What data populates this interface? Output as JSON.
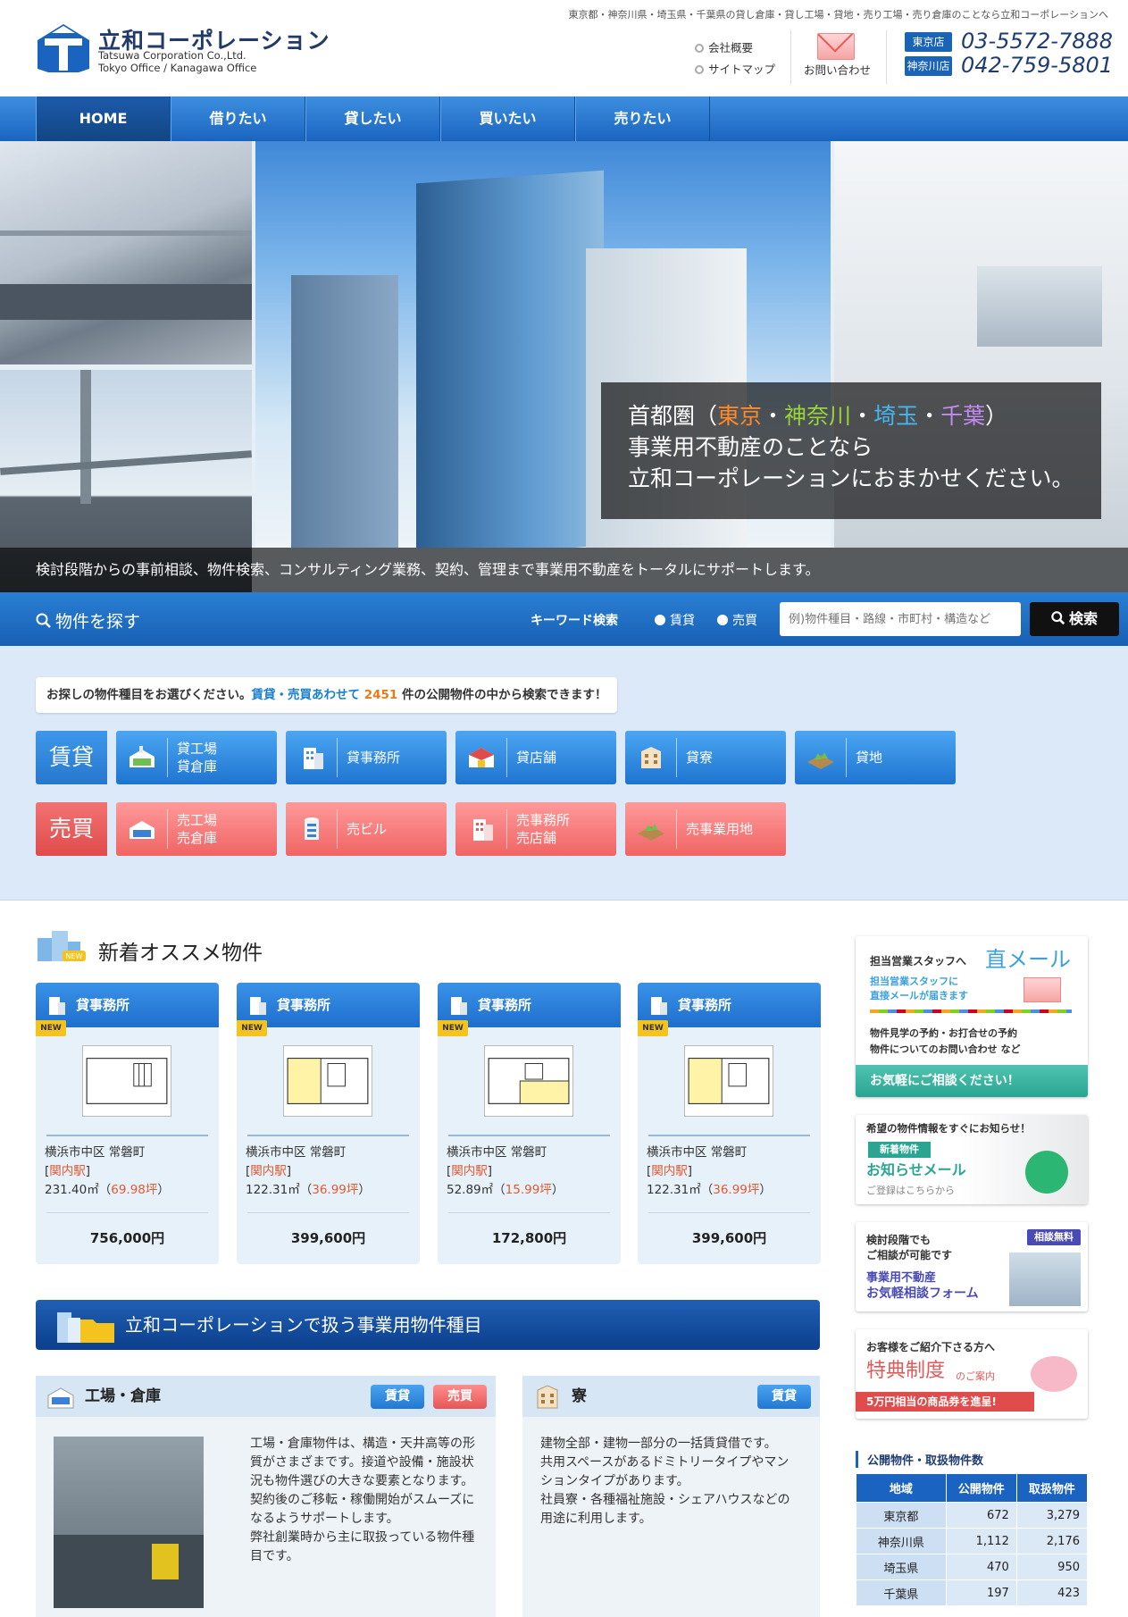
{
  "header": {
    "tagline": "東京都・神奈川県・埼玉県・千葉県の貸し倉庫・貸し工場・貸地・売り工場・売り倉庫のことなら立和コーポレーションへ",
    "company_name": "立和コーポレーション",
    "company_sub1": "Tatsuwa Corporation Co.,Ltd.",
    "company_sub2": "Tokyo Office / Kanagawa Office",
    "links": [
      "会社概要",
      "サイトマップ"
    ],
    "contact_label": "お問い合わせ",
    "offices": [
      {
        "badge": "東京店",
        "phone": "03-5572-7888"
      },
      {
        "badge": "神奈川店",
        "phone": "042-759-5801"
      }
    ]
  },
  "nav": [
    "HOME",
    "借りたい",
    "貸したい",
    "買いたい",
    "売りたい"
  ],
  "hero": {
    "lines": [
      "首都圏（",
      "東京",
      "・",
      "神奈川",
      "・",
      "埼玉",
      "・",
      "千葉",
      "）"
    ],
    "line2": "事業用不動産のことなら",
    "line3": "立和コーポレーションにおまかせください。",
    "caption": "検討段階からの事前相談、物件検索、コンサルティング業務、契約、管理まで事業用不動産をトータルにサポートします。",
    "colors": {
      "tokyo": "#ff8a2a",
      "kanagawa": "#9ad33a",
      "saitama": "#46b6f0",
      "chiba": "#c28af0"
    }
  },
  "search": {
    "title": "物件を探す",
    "keyword_label": "キーワード検索",
    "radio_lease": "賃貸",
    "radio_sale": "売買",
    "placeholder": "例)物件種目・路線・市町村・構造など",
    "button": "検索"
  },
  "categories": {
    "intro_a": "お探しの物件種目をお選びください。",
    "intro_b": "賃貸・売買あわせて",
    "intro_count": "2451",
    "intro_c": "件の公開物件の中から検索できます！",
    "lease_tag": "賃貸",
    "sale_tag": "売買",
    "lease": [
      {
        "l1": "貸工場",
        "l2": "貸倉庫"
      },
      {
        "l1": "貸事務所",
        "l2": ""
      },
      {
        "l1": "貸店舗",
        "l2": ""
      },
      {
        "l1": "貸寮",
        "l2": ""
      },
      {
        "l1": "貸地",
        "l2": ""
      }
    ],
    "sale": [
      {
        "l1": "売工場",
        "l2": "売倉庫"
      },
      {
        "l1": "売ビル",
        "l2": ""
      },
      {
        "l1": "売事務所",
        "l2": "売店舗"
      },
      {
        "l1": "売事業用地",
        "l2": ""
      }
    ]
  },
  "new_listings": {
    "title": "新着オススメ物件",
    "new_badge": "NEW",
    "items": [
      {
        "type": "貸事務所",
        "address": "横浜市中区 常磐町",
        "station": "関内駅",
        "area": "231.40㎡",
        "tsubo": "69.98坪",
        "price": "756,000円"
      },
      {
        "type": "貸事務所",
        "address": "横浜市中区 常磐町",
        "station": "関内駅",
        "area": "122.31㎡",
        "tsubo": "36.99坪",
        "price": "399,600円"
      },
      {
        "type": "貸事務所",
        "address": "横浜市中区 常磐町",
        "station": "関内駅",
        "area": "52.89㎡",
        "tsubo": "15.99坪",
        "price": "172,800円"
      },
      {
        "type": "貸事務所",
        "address": "横浜市中区 常磐町",
        "station": "関内駅",
        "area": "122.31㎡",
        "tsubo": "36.99坪",
        "price": "399,600円"
      }
    ]
  },
  "types_banner": "立和コーポレーションで扱う事業用物件種目",
  "types": [
    {
      "title": "工場・倉庫",
      "tags": [
        "賃貸",
        "売買"
      ],
      "body": [
        "工場・倉庫物件は、構造・天井高等の形",
        "質がさまざまです。接道や設備・施設状",
        "況も物件選びの大きな要素となります。",
        "契約後のご移転・稼働開始がスムーズに",
        "なるようサポートします。",
        "弊社創業時から主に取扱っている物件種",
        "目です。"
      ]
    },
    {
      "title": "寮",
      "tags": [
        "賃貸"
      ],
      "body": [
        "建物全部・建物一部分の一括賃貸借です。",
        "共用スペースがあるドミトリータイプやマン",
        "ションタイプがあります。",
        "社員寮・各種福祉施設・シェアハウスなどの",
        "用途に利用します。"
      ]
    }
  ],
  "sidebar": {
    "mail": {
      "a": "担当営業スタッフへ",
      "b": "直メール",
      "c": "担当営業スタッフに",
      "d": "直接メールが届きます",
      "e": "物件見学の予約・お打合せの予約",
      "f": "物件についてのお問い合わせ など",
      "g": "お気軽にご相談ください！"
    },
    "notify": {
      "a": "希望の物件情報をすぐにお知らせ！",
      "b": "新着物件",
      "c": "お知らせメール",
      "d": "ご登録はこちらから"
    },
    "consult": {
      "a": "検討段階でも",
      "b": "ご相談が可能です",
      "badge": "相談無料",
      "c": "事業用不動産",
      "d": "お気軽相談フォーム"
    },
    "referral": {
      "a": "お客様をご紹介下さる方へ",
      "b": "特典制度",
      "c": "のご案内",
      "d": "5万円相当の商品券を進呈!"
    }
  },
  "stats": {
    "title": "公開物件・取扱物件数",
    "headers": [
      "地域",
      "公開物件",
      "取扱物件"
    ],
    "rows": [
      [
        "東京都",
        "672",
        "3,279"
      ],
      [
        "神奈川県",
        "1,112",
        "2,176"
      ],
      [
        "埼玉県",
        "470",
        "950"
      ],
      [
        "千葉県",
        "197",
        "423"
      ]
    ]
  }
}
